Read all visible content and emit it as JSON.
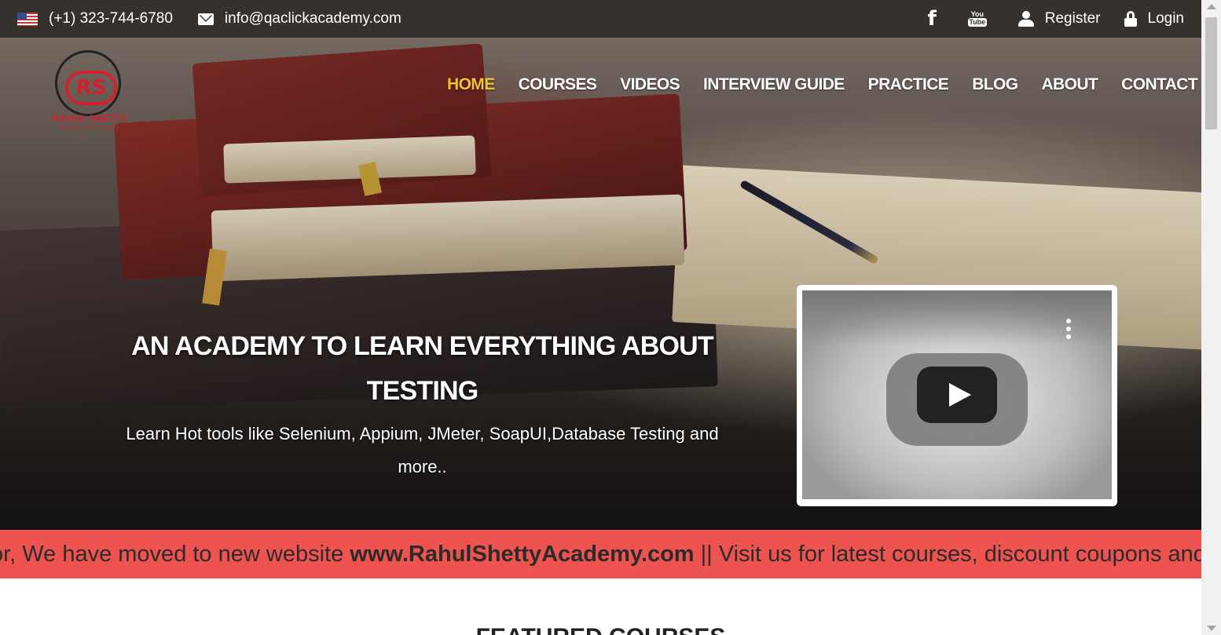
{
  "topbar": {
    "phone": "(+1) 323-744-6780",
    "email": "info@qaclickacademy.com",
    "register_label": "Register",
    "login_label": "Login",
    "youtube_top": "You",
    "youtube_bottom": "Tube"
  },
  "logo": {
    "monogram": "RS",
    "name": "RAHUL SHETTY",
    "sub": "ACADEMY",
    "tagline": "BECOME TEST EXPERT"
  },
  "nav": {
    "items": [
      {
        "label": "HOME",
        "active": true
      },
      {
        "label": "COURSES"
      },
      {
        "label": "VIDEOS"
      },
      {
        "label": "INTERVIEW GUIDE"
      },
      {
        "label": "PRACTICE"
      },
      {
        "label": "BLOG"
      },
      {
        "label": "ABOUT"
      },
      {
        "label": "CONTACT"
      }
    ]
  },
  "hero": {
    "headline": "AN ACADEMY TO LEARN EVERYTHING ABOUT TESTING",
    "subline": "Learn Hot tools like Selenium, Appium, JMeter, SoapUI,Database Testing and more.."
  },
  "ticker": {
    "prefix": "or, We have moved to new website ",
    "link": "www.RahulShettyAcademy.com",
    "suffix": " || Visit us for latest courses, discount coupons and"
  },
  "featured": {
    "title": "FEATURED COURSES"
  },
  "colors": {
    "topbar_bg": "#35312d",
    "nav_active": "#f1c232",
    "ticker_bg": "#ef5350",
    "brand_red": "#d4202a"
  },
  "icons": [
    "us-flag-icon",
    "envelope-icon",
    "facebook-icon",
    "youtube-icon",
    "user-icon",
    "lock-icon",
    "play-icon",
    "more-vertical-icon"
  ]
}
